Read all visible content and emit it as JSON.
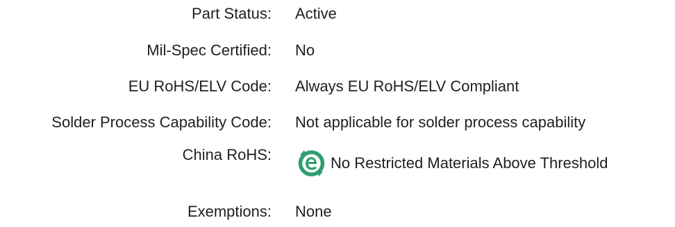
{
  "attributes": [
    {
      "label": "Part Status:",
      "value": "Active"
    },
    {
      "label": "Mil-Spec Certified:",
      "value": "No"
    },
    {
      "label": "EU RoHS/ELV Code:",
      "value": "Always EU RoHS/ELV Compliant"
    },
    {
      "label": "Solder Process Capability Code:",
      "value": "Not applicable for solder process capability"
    },
    {
      "label": "China RoHS:",
      "value": "No Restricted Materials Above Threshold",
      "icon": "china-rohs-e-icon"
    },
    {
      "label": "Exemptions:",
      "value": "None"
    }
  ],
  "colors": {
    "text": "#1f1f1f",
    "rohs_green": "#2f9e6e"
  }
}
